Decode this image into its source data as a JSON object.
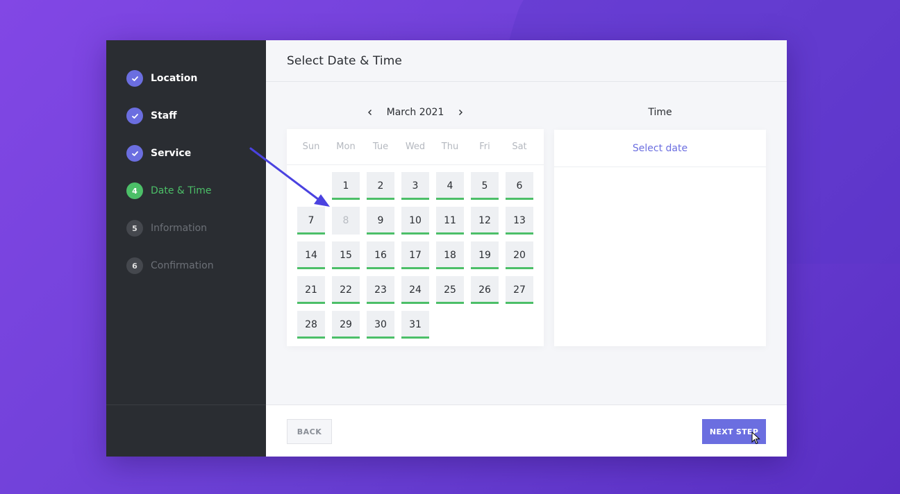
{
  "sidebar": {
    "steps": [
      {
        "number": "",
        "label": "Location",
        "state": "done",
        "icon": "check-icon"
      },
      {
        "number": "",
        "label": "Staff",
        "state": "done",
        "icon": "check-icon"
      },
      {
        "number": "",
        "label": "Service",
        "state": "done",
        "icon": "check-icon"
      },
      {
        "number": "4",
        "label": "Date & Time",
        "state": "active"
      },
      {
        "number": "5",
        "label": "Information",
        "state": "pending"
      },
      {
        "number": "6",
        "label": "Confirmation",
        "state": "pending"
      }
    ]
  },
  "main": {
    "title": "Select Date & Time",
    "calendar": {
      "month_label": "March 2021",
      "prev_icon": "chevron-left-icon",
      "next_icon": "chevron-right-icon",
      "weekdays": [
        "Sun",
        "Mon",
        "Tue",
        "Wed",
        "Thu",
        "Fri",
        "Sat"
      ],
      "leading_empty": 1,
      "days": [
        "1",
        "2",
        "3",
        "4",
        "5",
        "6",
        "7",
        "8",
        "9",
        "10",
        "11",
        "12",
        "13",
        "14",
        "15",
        "16",
        "17",
        "18",
        "19",
        "20",
        "21",
        "22",
        "23",
        "24",
        "25",
        "26",
        "27",
        "28",
        "29",
        "30",
        "31"
      ],
      "disabled_days": [
        "8"
      ]
    },
    "time": {
      "title": "Time",
      "placeholder": "Select date"
    }
  },
  "footer": {
    "back_label": "BACK",
    "next_label": "NEXT STEP"
  },
  "colors": {
    "accent": "#6b6ee0",
    "success": "#4cbf68",
    "sidebar_bg": "#2a2d32"
  }
}
